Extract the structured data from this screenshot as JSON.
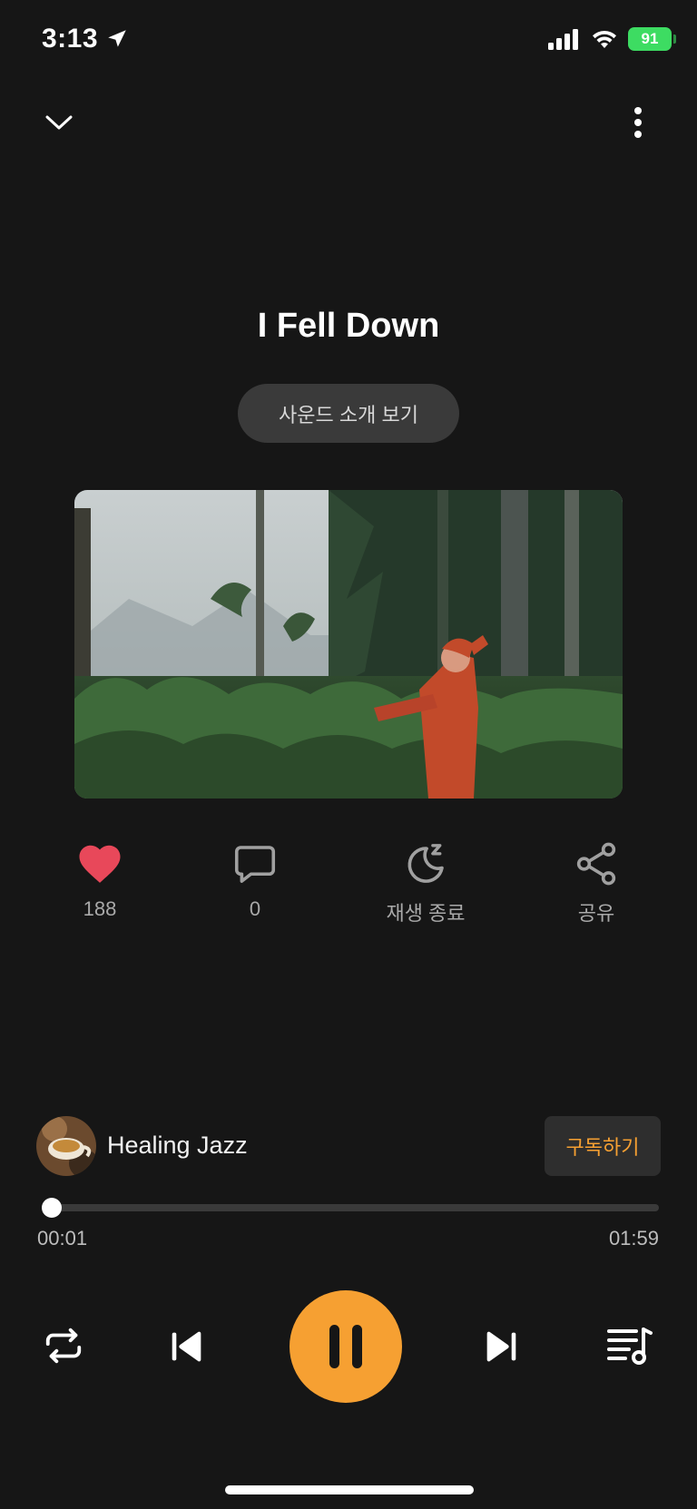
{
  "status_bar": {
    "time": "3:13",
    "battery": "91"
  },
  "header": {
    "title": "I Fell Down",
    "intro_button": "사운드 소개 보기"
  },
  "actions": {
    "like_count": "188",
    "comment_count": "0",
    "sleep_timer_label": "재생 종료",
    "share_label": "공유"
  },
  "channel": {
    "name": "Healing Jazz",
    "subscribe_label": "구독하기"
  },
  "player": {
    "current_time": "00:01",
    "duration": "01:59",
    "progress_fraction": 0.008
  },
  "colors": {
    "accent": "#f6a032",
    "like": "#e8485a",
    "background": "#161616"
  }
}
